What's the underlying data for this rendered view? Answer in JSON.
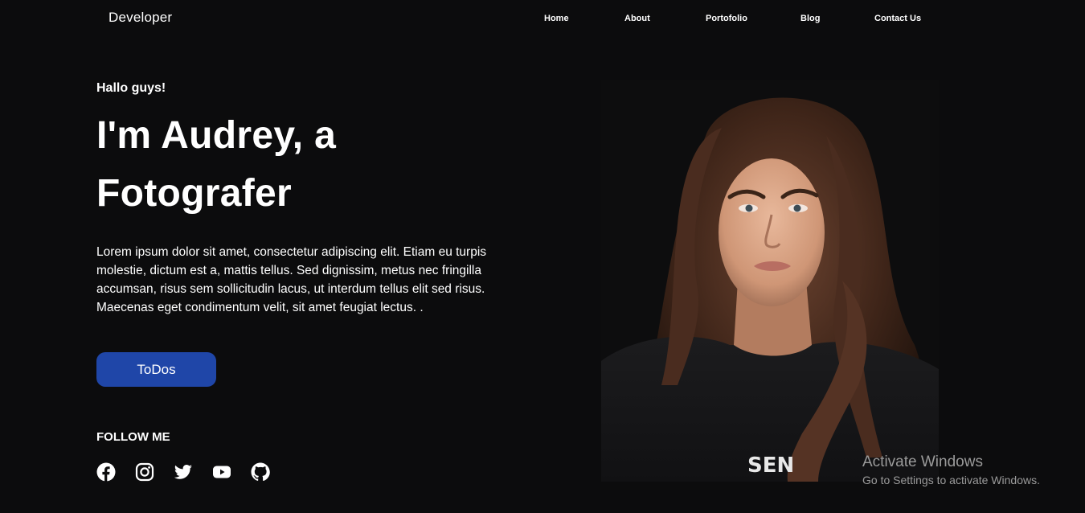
{
  "header": {
    "brand": "Developer",
    "nav": [
      "Home",
      "About",
      "Portofolio",
      "Blog",
      "Contact Us"
    ]
  },
  "hero": {
    "greeting": "Hallo guys!",
    "headline": "I'm Audrey, a Fotografer",
    "intro": "Lorem ipsum dolor sit amet, consectetur adipiscing elit. Etiam eu turpis molestie, dictum est a, mattis tellus. Sed dignissim, metus nec fringilla accumsan, risus sem sollicitudin lacus, ut interdum tellus elit sed risus. Maecenas eget condimentum velit, sit amet feugiat lectus. .",
    "button_label": "ToDos",
    "follow_label": "FOLLOW ME"
  },
  "socials": [
    {
      "icon": "facebook-icon"
    },
    {
      "icon": "instagram-icon"
    },
    {
      "icon": "twitter-icon"
    },
    {
      "icon": "youtube-icon"
    },
    {
      "icon": "github-icon"
    }
  ],
  "photo": {
    "shirt_text": "SEN"
  },
  "watermark": {
    "title": "Activate Windows",
    "subtitle": "Go to Settings to activate Windows."
  },
  "colors": {
    "background": "#0c0c0d",
    "button": "#1f46a8",
    "text": "#ffffff",
    "watermark": "#9a9a9a"
  }
}
